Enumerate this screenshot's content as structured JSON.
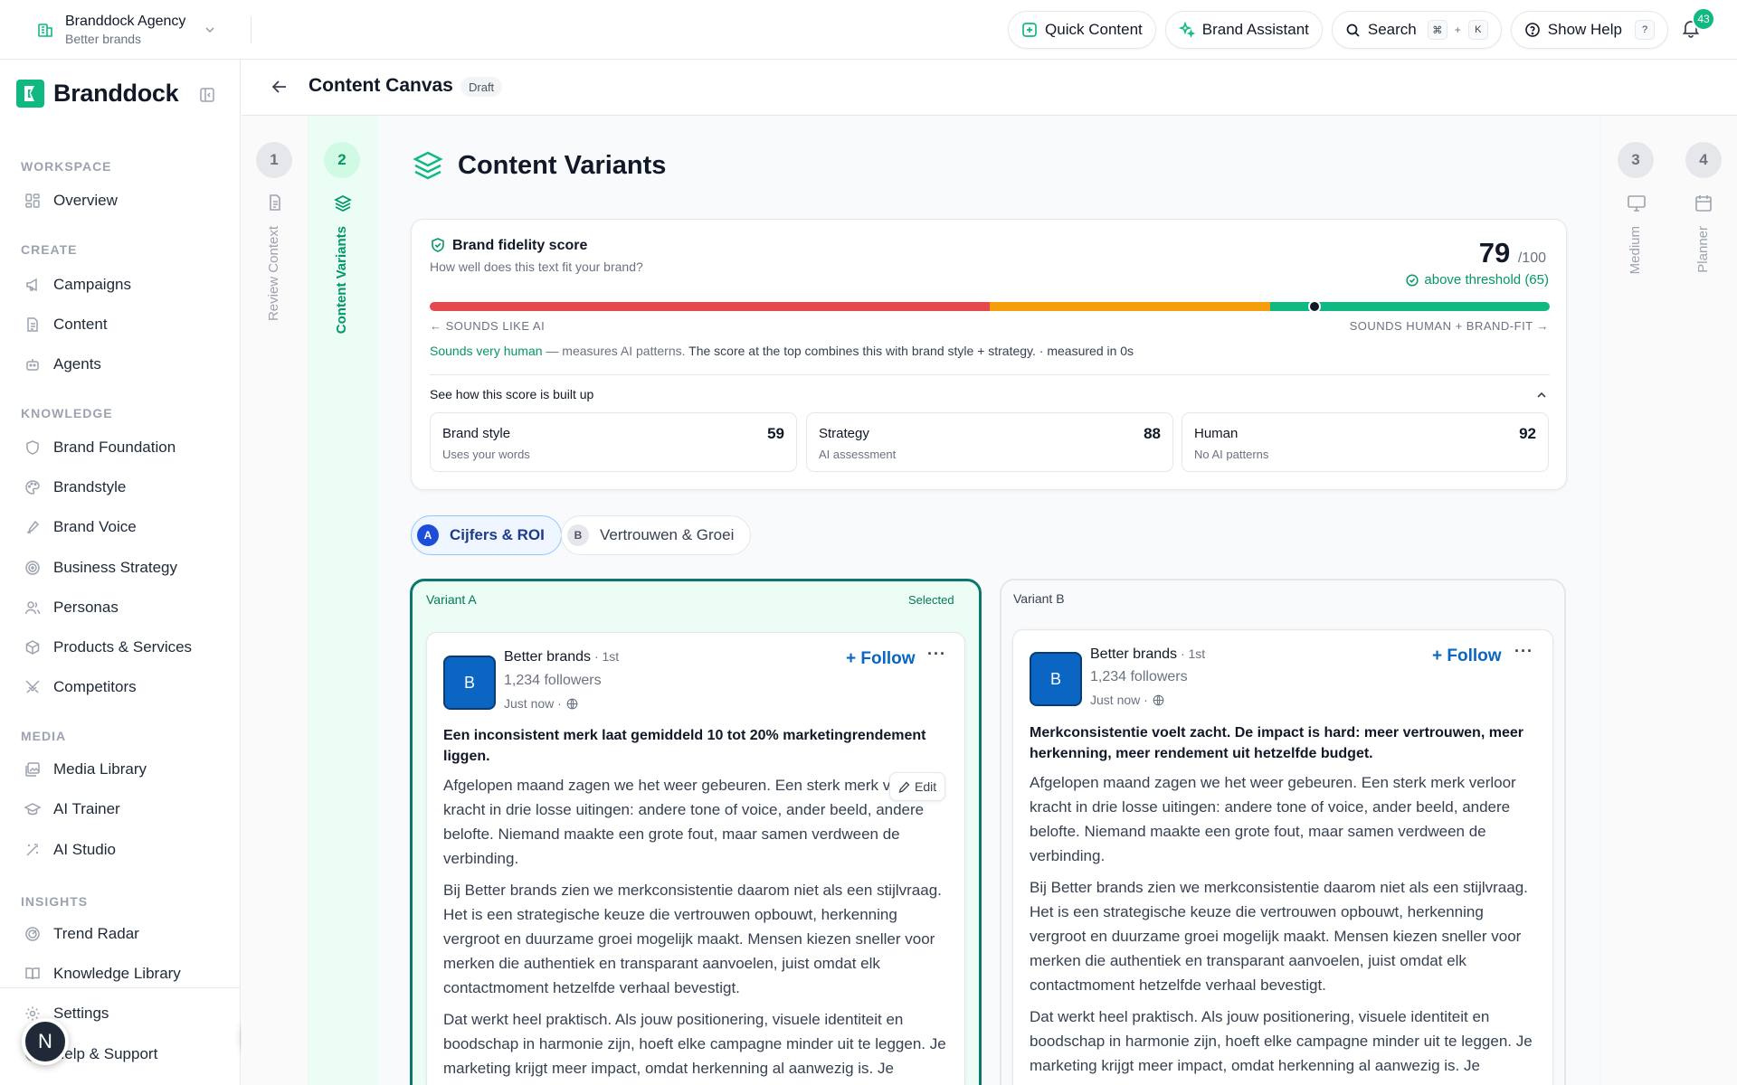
{
  "workspace": {
    "name": "Branddock Agency",
    "subtitle": "Better brands"
  },
  "top_actions": {
    "quick_content": "Quick Content",
    "brand_assistant": "Brand Assistant",
    "search": "Search",
    "search_kbd_1": "⌘",
    "search_kbd_plus": "+",
    "search_kbd_2": "K",
    "show_help": "Show Help",
    "help_kbd": "?",
    "notifications_count": "43"
  },
  "sidebar": {
    "brand_name": "Branddock",
    "sections": {
      "workspace": "WORKSPACE",
      "create": "CREATE",
      "knowledge": "KNOWLEDGE",
      "media": "MEDIA",
      "insights": "INSIGHTS"
    },
    "items": {
      "overview": "Overview",
      "campaigns": "Campaigns",
      "content": "Content",
      "agents": "Agents",
      "brand_foundation": "Brand Foundation",
      "brandstyle": "Brandstyle",
      "brand_voice": "Brand Voice",
      "business_strategy": "Business Strategy",
      "personas": "Personas",
      "products_services": "Products & Services",
      "competitors": "Competitors",
      "media_library": "Media Library",
      "ai_trainer": "AI Trainer",
      "ai_studio": "AI Studio",
      "trend_radar": "Trend Radar",
      "knowledge_library": "Knowledge Library",
      "settings": "Settings",
      "help_support": "Help & Support"
    },
    "user_initial": "N"
  },
  "header": {
    "title": "Content Canvas",
    "status": "Draft"
  },
  "steps": [
    {
      "number": "1",
      "label": "Review Context"
    },
    {
      "number": "2",
      "label": "Content Variants"
    },
    {
      "number": "3",
      "label": "Medium"
    },
    {
      "number": "4",
      "label": "Planner"
    }
  ],
  "main": {
    "title": "Content Variants",
    "fidelity": {
      "title": "Brand fidelity score",
      "subtitle": "How well does this text fit your brand?",
      "score": "79",
      "score_max": "/100",
      "threshold_text": "above threshold (65)",
      "bar_position": 0.79,
      "label_left": "← SOUNDS LIKE AI",
      "label_right": "SOUNDS HUMAN + BRAND-FIT →",
      "measure_green": "Sounds very human",
      "measure_mid": " — measures AI patterns. ",
      "measure_rest": "The score at the top combines this with brand style + strategy. · measured in 0s",
      "breakdown_title": "See how this score is built up",
      "breakdown": [
        {
          "name": "Brand style",
          "desc": "Uses your words",
          "score": "59"
        },
        {
          "name": "Strategy",
          "desc": "AI assessment",
          "score": "88"
        },
        {
          "name": "Human",
          "desc": "No AI patterns",
          "score": "92"
        }
      ]
    },
    "tabs": [
      {
        "letter": "A",
        "label": "Cijfers & ROI"
      },
      {
        "letter": "B",
        "label": "Vertrouwen & Groei"
      }
    ],
    "variants": [
      {
        "label": "Variant A",
        "selected_label": "Selected",
        "post": {
          "avatar": "B",
          "name": "Better brands",
          "degree": " · 1st",
          "followers": "1,234 followers",
          "time": "Just now ·",
          "follow": "+ Follow",
          "more": "···",
          "edit": "Edit",
          "headline": "Een inconsistent merk laat gemiddeld 10 tot 20% marketingrendement liggen.",
          "paragraphs": [
            "Afgelopen maand zagen we het weer gebeuren. Een sterk merk verloor kracht in drie losse uitingen: andere tone of voice, ander beeld, andere belofte. Niemand maakte een grote fout, maar samen verdween de verbinding.",
            "Bij Better brands zien we merkconsistentie daarom niet als een stijlvraag. Het is een strategische keuze die vertrouwen opbouwt, herkenning vergroot en duurzame groei mogelijk maakt. Mensen kiezen sneller voor merken die authentiek en transparant aanvoelen, juist omdat elk contactmoment hetzelfde verhaal bevestigt.",
            "Dat werkt heel praktisch. Als jouw positionering, visuele identiteit en boodschap in harmonie zijn, hoeft elke campagne minder uit te leggen. Je marketing krijgt meer impact, omdat herkenning al aanwezig is. Je"
          ]
        }
      },
      {
        "label": "Variant B",
        "post": {
          "avatar": "B",
          "name": "Better brands",
          "degree": " · 1st",
          "followers": "1,234 followers",
          "time": "Just now ·",
          "follow": "+ Follow",
          "more": "···",
          "headline": "Merkconsistentie voelt zacht. De impact is hard: meer vertrouwen, meer herkenning, meer rendement uit hetzelfde budget.",
          "paragraphs": [
            "Afgelopen maand zagen we het weer gebeuren. Een sterk merk verloor kracht in drie losse uitingen: andere tone of voice, ander beeld, andere belofte. Niemand maakte een grote fout, maar samen verdween de verbinding.",
            "Bij Better brands zien we merkconsistentie daarom niet als een stijlvraag. Het is een strategische keuze die vertrouwen opbouwt, herkenning vergroot en duurzame groei mogelijk maakt. Mensen kiezen sneller voor merken die authentiek en transparant aanvoelen, juist omdat elk contactmoment hetzelfde verhaal bevestigt.",
            "Dat werkt heel praktisch. Als jouw positionering, visuele identiteit en boodschap in harmonie zijn, hoeft elke campagne minder uit te leggen. Je marketing krijgt meer impact, omdat herkenning al aanwezig is. Je"
          ]
        }
      }
    ]
  },
  "colors": {
    "accent": "#10b981",
    "accent_dark": "#0f9d7a",
    "link_blue": "#0a66c2",
    "bar_red": "#e5484d",
    "bar_orange": "#f59e0b",
    "bar_green": "#10b981"
  }
}
